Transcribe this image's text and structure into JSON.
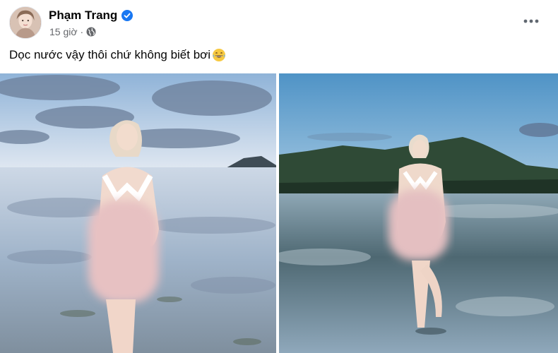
{
  "post": {
    "author": "Phạm Trang",
    "time": "15 giờ",
    "separator": "·",
    "privacy_icon": "globe-icon",
    "verified_icon": "verified-badge-icon",
    "more_icon": "more-options-icon",
    "caption": "Dọc nước vậy thôi chứ không biết bơi",
    "caption_emoji": "grinning-sweat-emoji-icon"
  },
  "photos": [
    {
      "name": "beach-photo-1",
      "scene": "woman-standing-shallow-water-cloudy-sky"
    },
    {
      "name": "beach-photo-2",
      "scene": "woman-standing-shallow-water-mountain"
    }
  ],
  "colors": {
    "verified": "#1877f2",
    "meta_text": "#65676b",
    "text": "#050505"
  }
}
